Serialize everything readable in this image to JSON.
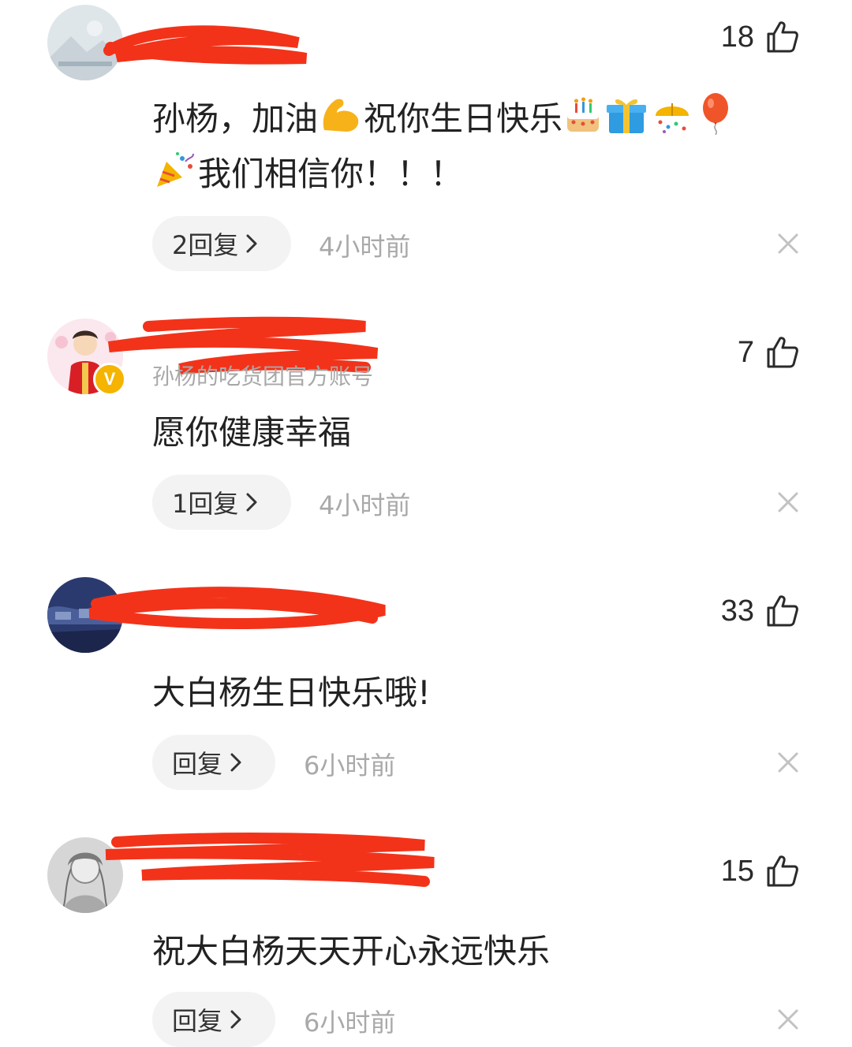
{
  "comments": [
    {
      "username": "",
      "subtitle": "",
      "likes": "18",
      "text_parts": [
        "孙杨，加油",
        "祝你生日快乐",
        "我们相信你！！！"
      ],
      "reply": "2回复",
      "time": "4小时前"
    },
    {
      "username": "",
      "subtitle": "孙杨的吃货团官方账号",
      "likes": "7",
      "text": "愿你健康幸福",
      "reply": "1回复",
      "time": "4小时前"
    },
    {
      "username": "",
      "subtitle": "",
      "likes": "33",
      "text": "大白杨生日快乐哦!",
      "reply": "回复",
      "time": "6小时前"
    },
    {
      "username": "",
      "subtitle": "",
      "likes": "15",
      "text": "祝大白杨天天开心永远快乐",
      "reply": "回复",
      "time": "6小时前"
    }
  ],
  "icons": {
    "like": "thumbs-up-icon",
    "close": "close-icon",
    "chevron": "chevron-right-icon",
    "verified": "verified-v-badge"
  },
  "verified_badge_letter": "V",
  "colors": {
    "redaction": "#f2331a",
    "muted_text": "#a9a9a9",
    "pill_bg": "#f3f3f3",
    "verified": "#f5b400"
  }
}
